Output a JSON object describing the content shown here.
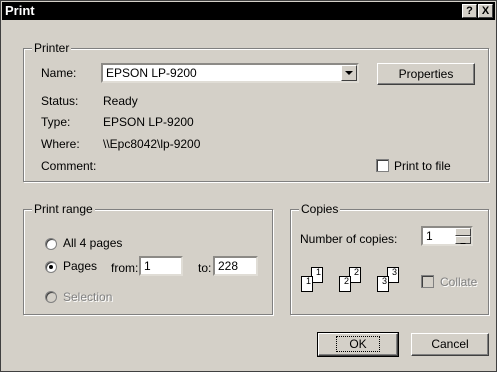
{
  "window": {
    "title": "Print",
    "help_label": "?",
    "close_label": "X"
  },
  "printer": {
    "group_label": "Printer",
    "name_label": "Name:",
    "name_value": "EPSON LP-9200",
    "properties_label": "Properties",
    "status_label": "Status:",
    "status_value": "Ready",
    "type_label": "Type:",
    "type_value": "EPSON LP-9200",
    "where_label": "Where:",
    "where_value": "\\\\Epc8042\\lp-9200",
    "comment_label": "Comment:",
    "comment_value": "",
    "print_to_file_label": "Print to file",
    "print_to_file_checked": false
  },
  "print_range": {
    "group_label": "Print range",
    "all_label": "All 4 pages",
    "pages_label": "Pages",
    "from_label": "from:",
    "from_value": "1",
    "to_label": "to:",
    "to_value": "228",
    "selection_label": "Selection",
    "selected": "pages"
  },
  "copies": {
    "group_label": "Copies",
    "number_label": "Number of copies:",
    "number_value": "1",
    "collate_label": "Collate",
    "collate_enabled": false,
    "icon_pages": [
      "1",
      "1",
      "2",
      "2",
      "3",
      "3"
    ]
  },
  "buttons": {
    "ok_label": "OK",
    "cancel_label": "Cancel"
  }
}
